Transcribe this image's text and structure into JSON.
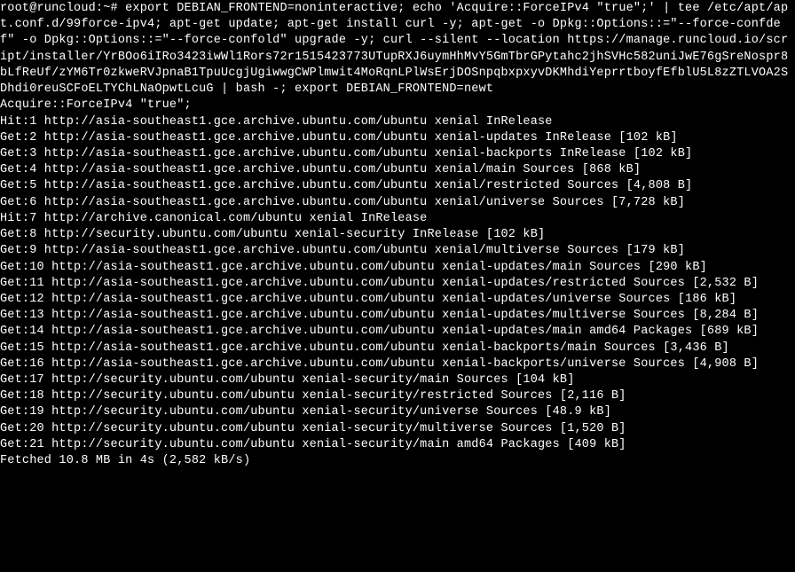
{
  "prompt": "root@runcloud:~# ",
  "command": "export DEBIAN_FRONTEND=noninteractive; echo 'Acquire::ForceIPv4 \"true\";' | tee /etc/apt/apt.conf.d/99force-ipv4; apt-get update; apt-get install curl -y; apt-get -o Dpkg::Options::=\"--force-confdef\" -o Dpkg::Options::=\"--force-confold\" upgrade -y; curl --silent --location https://manage.runcloud.io/script/installer/YrBOo6iIRo3423iwWl1Rors72r1515423773UTupRXJ6uymHhMvY5GmTbrGPytahc2jhSVHc582uniJwE76gSreNospr8bLfReUf/zYM6Tr0zkweRVJpnaB1TpuUcgjUgiwwgCWPlmwit4MoRqnLPlWsErjDOSnpqbxpxyvDKMhdiYeprrtboyfEfblU5L8zZTLVOA2SDhdi0reuSCFoELTYChLNaOpwtLcuG | bash -; export DEBIAN_FRONTEND=newt",
  "output": [
    "Acquire::ForceIPv4 \"true\";",
    "Hit:1 http://asia-southeast1.gce.archive.ubuntu.com/ubuntu xenial InRelease",
    "Get:2 http://asia-southeast1.gce.archive.ubuntu.com/ubuntu xenial-updates InRelease [102 kB]",
    "Get:3 http://asia-southeast1.gce.archive.ubuntu.com/ubuntu xenial-backports InRelease [102 kB]",
    "Get:4 http://asia-southeast1.gce.archive.ubuntu.com/ubuntu xenial/main Sources [868 kB]",
    "Get:5 http://asia-southeast1.gce.archive.ubuntu.com/ubuntu xenial/restricted Sources [4,808 B]",
    "Get:6 http://asia-southeast1.gce.archive.ubuntu.com/ubuntu xenial/universe Sources [7,728 kB]",
    "Hit:7 http://archive.canonical.com/ubuntu xenial InRelease",
    "Get:8 http://security.ubuntu.com/ubuntu xenial-security InRelease [102 kB]",
    "Get:9 http://asia-southeast1.gce.archive.ubuntu.com/ubuntu xenial/multiverse Sources [179 kB]",
    "Get:10 http://asia-southeast1.gce.archive.ubuntu.com/ubuntu xenial-updates/main Sources [290 kB]",
    "Get:11 http://asia-southeast1.gce.archive.ubuntu.com/ubuntu xenial-updates/restricted Sources [2,532 B]",
    "Get:12 http://asia-southeast1.gce.archive.ubuntu.com/ubuntu xenial-updates/universe Sources [186 kB]",
    "Get:13 http://asia-southeast1.gce.archive.ubuntu.com/ubuntu xenial-updates/multiverse Sources [8,284 B]",
    "Get:14 http://asia-southeast1.gce.archive.ubuntu.com/ubuntu xenial-updates/main amd64 Packages [689 kB]",
    "Get:15 http://asia-southeast1.gce.archive.ubuntu.com/ubuntu xenial-backports/main Sources [3,436 B]",
    "Get:16 http://asia-southeast1.gce.archive.ubuntu.com/ubuntu xenial-backports/universe Sources [4,908 B]",
    "Get:17 http://security.ubuntu.com/ubuntu xenial-security/main Sources [104 kB]",
    "Get:18 http://security.ubuntu.com/ubuntu xenial-security/restricted Sources [2,116 B]",
    "Get:19 http://security.ubuntu.com/ubuntu xenial-security/universe Sources [48.9 kB]",
    "Get:20 http://security.ubuntu.com/ubuntu xenial-security/multiverse Sources [1,520 B]",
    "Get:21 http://security.ubuntu.com/ubuntu xenial-security/main amd64 Packages [409 kB]",
    "Fetched 10.8 MB in 4s (2,582 kB/s)"
  ]
}
